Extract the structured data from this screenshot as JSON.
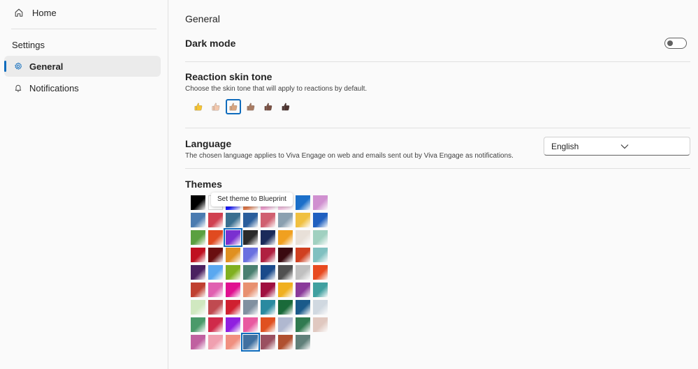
{
  "sidebar": {
    "home_label": "Home",
    "settings_header": "Settings",
    "items": [
      {
        "label": "General",
        "active": true,
        "icon": "gear-icon"
      },
      {
        "label": "Notifications",
        "active": false,
        "icon": "bell-icon"
      }
    ]
  },
  "main": {
    "title": "General",
    "dark_mode": {
      "label": "Dark mode",
      "enabled": false
    },
    "skin_tone": {
      "title": "Reaction skin tone",
      "description": "Choose the skin tone that will apply to reactions by default.",
      "tones": [
        {
          "name": "default",
          "color": "#f7c431"
        },
        {
          "name": "light",
          "color": "#f3c8ad"
        },
        {
          "name": "medium-light",
          "color": "#d9a57e"
        },
        {
          "name": "medium",
          "color": "#a87b62"
        },
        {
          "name": "medium-dark",
          "color": "#7a5043"
        },
        {
          "name": "dark",
          "color": "#4d3430"
        }
      ],
      "selected_index": 2
    },
    "language": {
      "title": "Language",
      "description": "The chosen language applies to Viva Engage on web and emails sent out by Viva Engage as notifications.",
      "selected": "English"
    },
    "themes": {
      "title": "Themes",
      "tooltip": "Set theme to Blueprint",
      "selected_indices": [
        18,
        67
      ],
      "swatches": [
        "#000000",
        "#ffffff",
        "#1a1aff",
        "#e0784a",
        "#f0a0d0",
        "#f2c0e0",
        "#1b6fc9",
        "#d090d0",
        "#4a7bb0",
        "#d04050",
        "#3a6f90",
        "#2a5e9c",
        "#d06070",
        "#8aa0b0",
        "#f0c040",
        "#2060c0",
        "#5aa040",
        "#e04a20",
        "#7a2fd0",
        "#2a2a2a",
        "#1a2a5a",
        "#f0a020",
        "#e8e0d8",
        "#a0d0c0",
        "#c01020",
        "#6a0f10",
        "#e09020",
        "#6a70e0",
        "#b02040",
        "#3a0a10",
        "#d04020",
        "#80c0c0",
        "#4a2060",
        "#5aa8f0",
        "#80b020",
        "#4a8070",
        "#1a4a8a",
        "#505050",
        "#c0c0c0",
        "#e84a20",
        "#c04030",
        "#e060b0",
        "#e01090",
        "#e89070",
        "#a01040",
        "#f0b020",
        "#8a3a9a",
        "#40a0a0",
        "#d0e8c0",
        "#c04a50",
        "#d02030",
        "#8090a0",
        "#2a8aa0",
        "#1a6a3a",
        "#1a5a8a",
        "#d0d8e0",
        "#4a9a6a",
        "#d02a4a",
        "#9020e0",
        "#e85aa0",
        "#e05020",
        "#b0b8d0",
        "#307a50",
        "#e0c8c0",
        "#c060a0",
        "#f0a0b0",
        "#f09080",
        "#4070a0",
        "#9a5060",
        "#b05030",
        "#60807a"
      ]
    }
  },
  "colors": {
    "accent": "#0f6cbd"
  }
}
